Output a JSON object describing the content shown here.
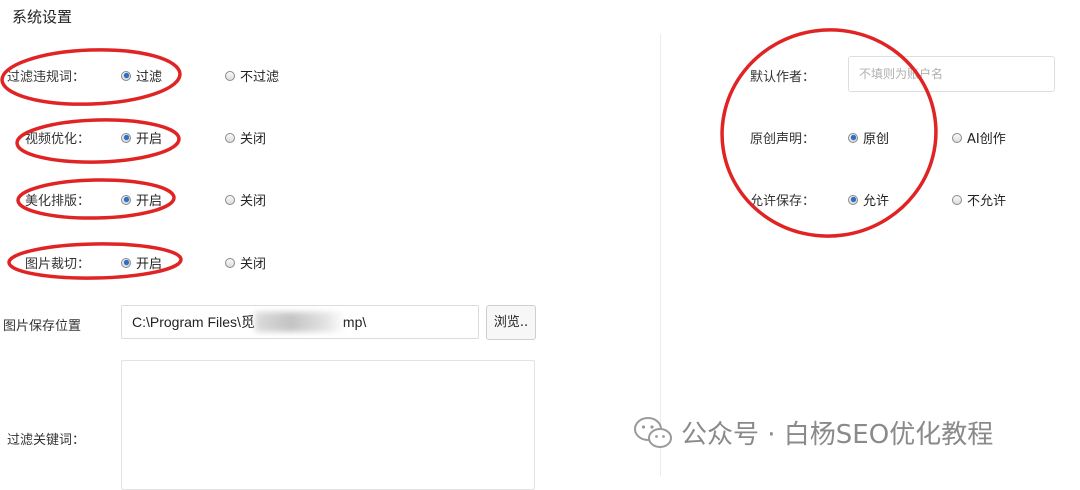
{
  "window": {
    "title": "系统设置"
  },
  "left": {
    "filter_words": {
      "label": "过滤违规词：",
      "options": [
        "过滤",
        "不过滤"
      ],
      "selected": "过滤"
    },
    "video_opt": {
      "label": "视频优化：",
      "options": [
        "开启",
        "关闭"
      ],
      "selected": "开启"
    },
    "beautify": {
      "label": "美化排版：",
      "options": [
        "开启",
        "关闭"
      ],
      "selected": "开启"
    },
    "image_crop": {
      "label": "图片裁切：",
      "options": [
        "开启",
        "关闭"
      ],
      "selected": "开启"
    },
    "image_save": {
      "label": "图片保存位置",
      "value": "C:\\Program Files\\觅",
      "value_tail": "mp\\",
      "browse_label": "浏览.."
    },
    "filter_keywords": {
      "label": "过滤关键词：",
      "value": ""
    }
  },
  "right": {
    "default_author": {
      "label": "默认作者：",
      "placeholder": "不填则为账户名"
    },
    "original": {
      "label": "原创声明：",
      "options": [
        "原创",
        "AI创作"
      ],
      "selected": "原创"
    },
    "allow_save": {
      "label": "允许保存：",
      "options": [
        "允许",
        "不允许"
      ],
      "selected": "允许"
    }
  },
  "watermark": {
    "text": "公众号 · 白杨SEO优化教程",
    "icon": "wechat-icon"
  },
  "colors": {
    "annotation_red": "#e02424",
    "radio_selected": "#2a6fc9"
  }
}
